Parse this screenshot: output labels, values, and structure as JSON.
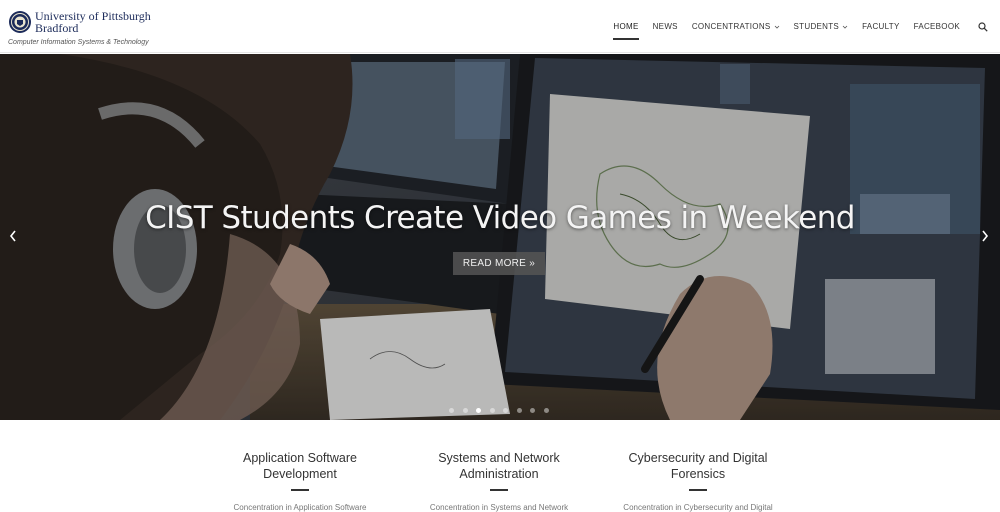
{
  "header": {
    "logo_title": "University of Pittsburgh Bradford",
    "logo_title_line1": "University of Pittsburgh",
    "logo_title_line2": "Bradford",
    "logo_subtitle": "Computer Information Systems & Technology",
    "nav": [
      {
        "label": "HOME",
        "active": true
      },
      {
        "label": "NEWS"
      },
      {
        "label": "CONCENTRATIONS",
        "dropdown": true
      },
      {
        "label": "STUDENTS",
        "dropdown": true
      },
      {
        "label": "FACULTY"
      },
      {
        "label": "FACEBOOK"
      }
    ],
    "search_icon": "search-icon"
  },
  "hero": {
    "title": "CIST Students Create Video Games in Weekend",
    "button": "READ MORE »",
    "slide_count": 8,
    "active_slide": 3
  },
  "concentrations": [
    {
      "title_line1": "Application Software",
      "title_line2": "Development",
      "desc": "Concentration in Application Software"
    },
    {
      "title_line1": "Systems and Network",
      "title_line2": "Administration",
      "desc": "Concentration in Systems and Network"
    },
    {
      "title_line1": "Cybersecurity and Digital",
      "title_line2": "Forensics",
      "desc": "Concentration in Cybersecurity and Digital"
    }
  ],
  "colors": {
    "brand": "#1c2b5a",
    "text": "#333333",
    "button_bg": "#555555"
  }
}
